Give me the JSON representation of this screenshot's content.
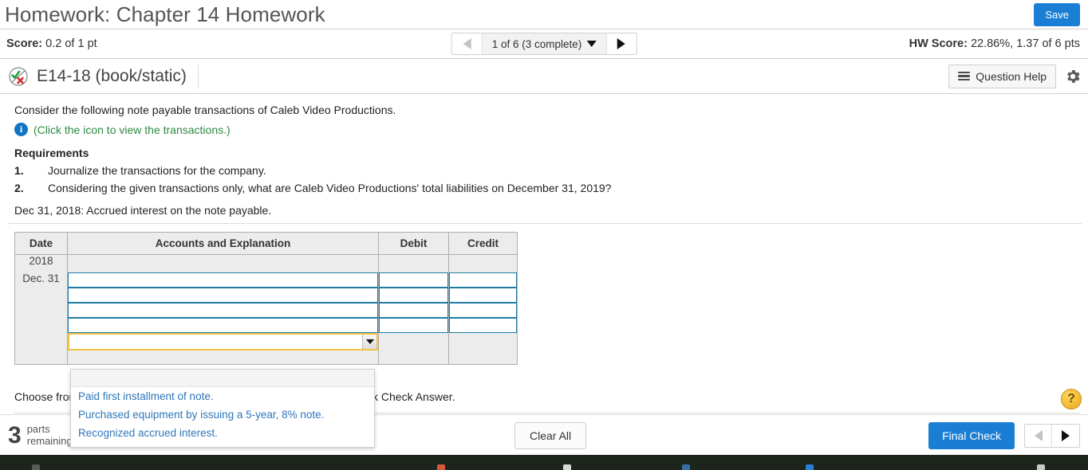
{
  "header": {
    "title": "Homework: Chapter 14 Homework",
    "save_label": "Save"
  },
  "score_bar": {
    "score_label": "Score:",
    "score_value": "0.2 of 1 pt",
    "pager_label": "1 of 6 (3 complete)",
    "prev_icon": "triangle-left-icon",
    "next_icon": "triangle-right-icon",
    "hw_score_label": "HW Score:",
    "hw_score_value": "22.86%, 1.37 of 6 pts"
  },
  "question_bar": {
    "status_icon": "check-x-circle-icon",
    "question_id": "E14-18 (book/static)",
    "help_label": "Question Help",
    "help_icon": "list-icon",
    "settings_icon": "gear-icon"
  },
  "question": {
    "intro": "Consider the following note payable transactions of Caleb Video Productions.",
    "info_icon": "info-icon",
    "info_link": "(Click the icon to view the transactions.)",
    "requirements_title": "Requirements",
    "requirements": [
      {
        "num": "1.",
        "text": "Journalize the transactions for the company."
      },
      {
        "num": "2.",
        "text": "Considering the given transactions only, what are Caleb Video Productions' total liabilities on December 31, 2019?"
      }
    ],
    "prompt": "Dec 31, 2018: Accrued interest on the note payable."
  },
  "journal": {
    "columns": [
      "Date",
      "Accounts and Explanation",
      "Debit",
      "Credit"
    ],
    "date_year": "2018",
    "date_day": "Dec. 31",
    "rows": [
      {
        "account": "",
        "debit": "",
        "credit": ""
      },
      {
        "account": "",
        "debit": "",
        "credit": ""
      },
      {
        "account": "",
        "debit": "",
        "credit": ""
      },
      {
        "account": "",
        "debit": "",
        "credit": ""
      }
    ],
    "explanation_select": {
      "value": "",
      "caret_icon": "caret-down-icon",
      "expanded": true,
      "options": [
        "",
        "Paid first installment of note.",
        "Purchased equipment by issuing a 5-year, 8% note.",
        "Recognized accrued interest."
      ]
    }
  },
  "instruction": {
    "text": "Choose from any list or enter any number in the input fields and then click Check Answer."
  },
  "footer": {
    "parts_count": "3",
    "parts_line1": "parts",
    "parts_line2": "remaining",
    "clear_all_label": "Clear All",
    "final_check_label": "Final Check",
    "prev_icon": "triangle-left-icon",
    "next_icon": "triangle-right-icon",
    "help_badge": "?"
  },
  "colors": {
    "primary_blue": "#1a7fd4",
    "link_blue": "#2f76b8",
    "link_green": "#2d8a41",
    "input_border": "#1d7ba3",
    "focus_gold": "#f5c344",
    "table_bg": "#ececec"
  }
}
